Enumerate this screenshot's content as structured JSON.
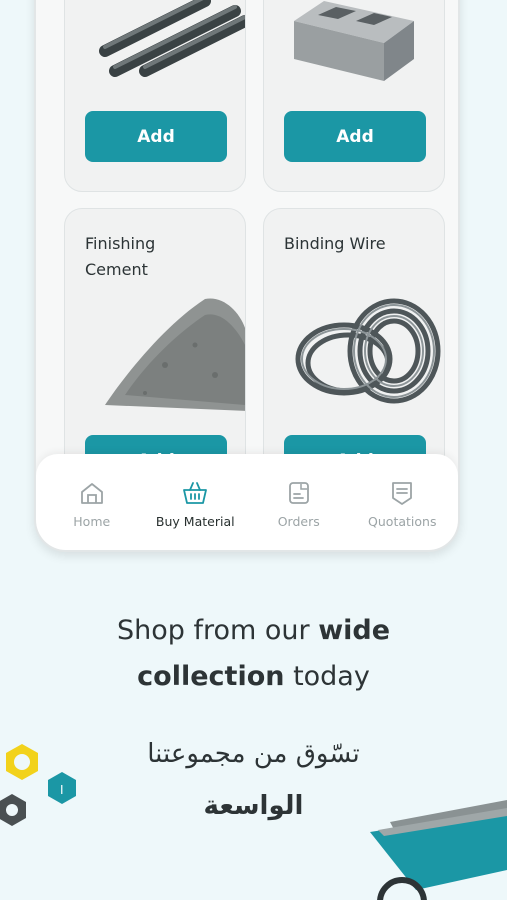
{
  "products": [
    {
      "title": "",
      "button": "Add"
    },
    {
      "title": "",
      "button": "Add"
    },
    {
      "title": "Finishing\nCement",
      "button": "Add"
    },
    {
      "title": "Binding Wire",
      "button": "Add"
    }
  ],
  "nav": {
    "items": [
      {
        "label": "Home",
        "icon": "home-icon",
        "active": false
      },
      {
        "label": "Buy Material",
        "icon": "basket-icon",
        "active": true
      },
      {
        "label": "Orders",
        "icon": "orders-icon",
        "active": false
      },
      {
        "label": "Quotations",
        "icon": "quotation-icon",
        "active": false
      }
    ]
  },
  "promo": {
    "line1_regular": "Shop from our ",
    "line1_bold": "wide",
    "line2_bold": "collection",
    "line2_regular": " today",
    "arabic_line1": "تسّوق من مجموعتنا",
    "arabic_line2": "الواسعة"
  },
  "colors": {
    "accent": "#1b97a5",
    "background": "#eef8fa",
    "yellow": "#f2d21b"
  }
}
